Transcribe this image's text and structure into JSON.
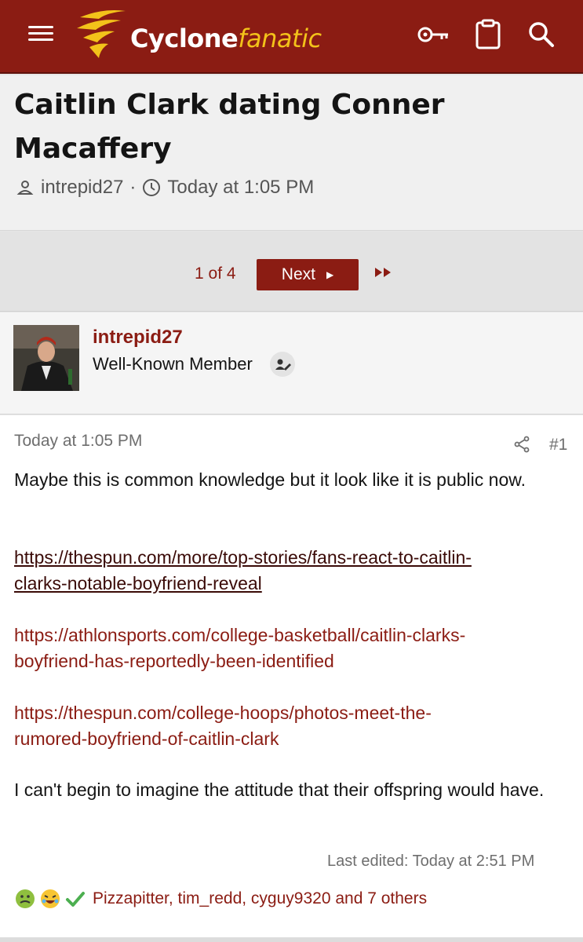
{
  "header": {
    "logo_part1": "Cyclone",
    "logo_part2": "fanatic",
    "brand_color": "#8b1c13",
    "accent_color": "#f3c21a",
    "icons": [
      "menu-icon",
      "key-icon",
      "clipboard-icon",
      "search-icon"
    ]
  },
  "thread": {
    "title": "Caitlin Clark dating Conner Macaffery",
    "author": "intrepid27",
    "separator": "·",
    "time": "Today at 1:05 PM"
  },
  "pagination": {
    "current": "1 of 4",
    "next_label": "Next"
  },
  "user": {
    "name": "intrepid27",
    "title": "Well-Known Member"
  },
  "post": {
    "date": "Today at 1:05 PM",
    "number": "#1",
    "para1": "Maybe this is common knowledge but it look like it is public now.",
    "link1_line1": "https://thespun.com/more/top-stories/fans-react-to-caitlin-",
    "link1_line2": "clarks-notable-boyfriend-reveal",
    "link2_line1": "https://athlonsports.com/college-basketball/caitlin-clarks-",
    "link2_line2": "boyfriend-has-reportedly-been-identified",
    "link3_line1": "https://thespun.com/college-hoops/photos-meet-the-",
    "link3_line2": "rumored-boyfriend-of-caitlin-clark",
    "para2": "I can't begin to imagine the attitude that their offspring would have.",
    "last_edited": "Last edited: Today at 2:51 PM",
    "reactions_text": "Pizzapitter, tim_redd, cyguy9320 and 7 others",
    "reaction_icons": [
      "nauseated-face-icon",
      "laughing-face-icon",
      "check-mark-icon"
    ]
  }
}
